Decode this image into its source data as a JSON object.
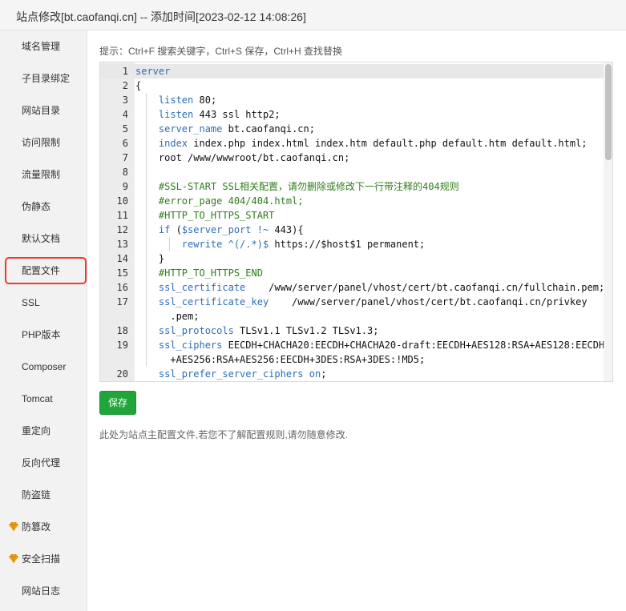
{
  "window": {
    "title": "站点修改[bt.caofanqi.cn] -- 添加时间[2023-02-12 14:08:26]"
  },
  "sidebar": {
    "items": [
      {
        "label": "域名管理"
      },
      {
        "label": "子目录绑定"
      },
      {
        "label": "网站目录"
      },
      {
        "label": "访问限制"
      },
      {
        "label": "流量限制"
      },
      {
        "label": "伪静态"
      },
      {
        "label": "默认文档"
      },
      {
        "label": "配置文件",
        "active": true
      },
      {
        "label": "SSL"
      },
      {
        "label": "PHP版本"
      },
      {
        "label": "Composer"
      },
      {
        "label": "Tomcat"
      },
      {
        "label": "重定向"
      },
      {
        "label": "反向代理"
      },
      {
        "label": "防盗链"
      },
      {
        "label": "防篡改",
        "icon": "gem-icon"
      },
      {
        "label": "安全扫描",
        "icon": "gem-icon"
      },
      {
        "label": "网站日志"
      }
    ],
    "active_color": "#ee3b2b",
    "gem_color": "#f0a31b"
  },
  "main": {
    "hint": "提示：Ctrl+F 搜索关键字，Ctrl+S 保存，Ctrl+H 查找替换",
    "save_label": "保存",
    "note": "此处为站点主配置文件,若您不了解配置规则,请勿随意修改.",
    "editor": {
      "lines": [
        {
          "n": "1",
          "text": "server"
        },
        {
          "n": "2",
          "text": "{"
        },
        {
          "n": "3",
          "text": "    listen 80;"
        },
        {
          "n": "4",
          "text": "    listen 443 ssl http2;"
        },
        {
          "n": "5",
          "text": "    server_name bt.caofanqi.cn;"
        },
        {
          "n": "6",
          "text": "    index index.php index.html index.htm default.php default.htm default.html;"
        },
        {
          "n": "7",
          "text": "    root /www/wwwroot/bt.caofanqi.cn;"
        },
        {
          "n": "8",
          "text": ""
        },
        {
          "n": "9",
          "text": "    #SSL-START SSL相关配置，请勿删除或修改下一行带注释的404规则"
        },
        {
          "n": "10",
          "text": "    #error_page 404/404.html;"
        },
        {
          "n": "11",
          "text": "    #HTTP_TO_HTTPS_START"
        },
        {
          "n": "12",
          "text": "    if ($server_port !~ 443){"
        },
        {
          "n": "13",
          "text": "        rewrite ^(/.*)$ https://$host$1 permanent;"
        },
        {
          "n": "14",
          "text": "    }"
        },
        {
          "n": "15",
          "text": "    #HTTP_TO_HTTPS_END"
        },
        {
          "n": "16",
          "text": "    ssl_certificate    /www/server/panel/vhost/cert/bt.caofanqi.cn/fullchain.pem;"
        },
        {
          "n": "17",
          "text": "    ssl_certificate_key    /www/server/panel/vhost/cert/bt.caofanqi.cn/privkey"
        },
        {
          "n": "",
          "text": "      .pem;"
        },
        {
          "n": "18",
          "text": "    ssl_protocols TLSv1.1 TLSv1.2 TLSv1.3;"
        },
        {
          "n": "19",
          "text": "    ssl_ciphers EECDH+CHACHA20:EECDH+CHACHA20-draft:EECDH+AES128:RSA+AES128:EECDH"
        },
        {
          "n": "",
          "text": "      +AES256:RSA+AES256:EECDH+3DES:RSA+3DES:!MD5;"
        },
        {
          "n": "20",
          "text": "    ssl_prefer_server_ciphers on;"
        }
      ]
    }
  },
  "colors": {
    "primary_button": "#20a53a",
    "keyword": "#2d6eb6",
    "comment": "#2f7d1b"
  }
}
